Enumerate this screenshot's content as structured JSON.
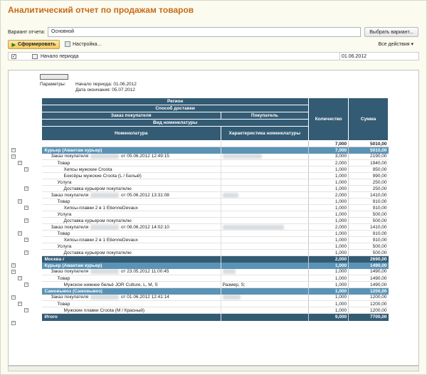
{
  "title": "Аналитический отчет по продажам товаров",
  "variant": {
    "label": "Вариант отчета:",
    "value": "Основной",
    "choose_button": "Выбрать вариант..."
  },
  "toolbar": {
    "form_button": "Сформировать",
    "settings": "Настройка...",
    "all_actions": "Все действия"
  },
  "period": {
    "label": "Начало периода",
    "value": "01.06.2012"
  },
  "params": {
    "label": "Параметры:",
    "start": "Начало периода: 01.06.2012",
    "end": "Дата окончания: 05.07.2012"
  },
  "headers": {
    "region": "Регион",
    "delivery": "Способ доставки",
    "order": "Заказ покупателя",
    "buyer": "Покупатель",
    "nomen_kind": "Вид номенклатуры",
    "nomen": "Номенклатура",
    "nomen_char": "Характеристика номенклатуры",
    "qty": "Количество",
    "sum": "Сумма"
  },
  "rows": [
    {
      "cls": "total",
      "indent": 0,
      "text": "",
      "char": "",
      "qty": "7,000",
      "sum": "5010,00"
    },
    {
      "cls": "g2",
      "indent": 0,
      "text": "Курьер (Авантаж курьер)",
      "char": "",
      "qty": "7,000",
      "sum": "5010,00"
    },
    {
      "cls": "r",
      "indent": 1,
      "text": "Заказ покупателя",
      "blur": "00000000000",
      "suffix": "от 05.06.2012 12:49:15",
      "buyer": "Фамилия Имя Отч",
      "qty": "3,000",
      "sum": "2190,00"
    },
    {
      "cls": "r",
      "indent": 2,
      "text": "Товар",
      "char": "",
      "qty": "2,000",
      "sum": "1940,00"
    },
    {
      "cls": "r",
      "indent": 3,
      "text": "Хипсы мужские Croota",
      "char": "",
      "qty": "1,000",
      "sum": "950,00"
    },
    {
      "cls": "r",
      "indent": 3,
      "text": "Боксёры мужские Croota (L / Белый)",
      "char": "",
      "qty": "1,000",
      "sum": "990,00"
    },
    {
      "cls": "r",
      "indent": 2,
      "text": "Услуга",
      "char": "",
      "qty": "1,000",
      "sum": "250,00"
    },
    {
      "cls": "r",
      "indent": 3,
      "text": "Доставка курьером покупателю",
      "char": "",
      "qty": "1,000",
      "sum": "250,00"
    },
    {
      "cls": "r",
      "indent": 1,
      "text": "Заказ покупателя",
      "blur": "00000000000",
      "suffix": "от 05.06.2012 13:31:08",
      "buyer": "Матвей",
      "qty": "2,000",
      "sum": "1410,00"
    },
    {
      "cls": "r",
      "indent": 2,
      "text": "Товар",
      "char": "",
      "qty": "1,000",
      "sum": "910,00"
    },
    {
      "cls": "r",
      "indent": 3,
      "text": "Хипсы-плавки 2 в 1 EtienneDevaux",
      "char": "",
      "qty": "1,000",
      "sum": "910,00"
    },
    {
      "cls": "r",
      "indent": 2,
      "text": "Услуга",
      "char": "",
      "qty": "1,000",
      "sum": "500,00"
    },
    {
      "cls": "r",
      "indent": 3,
      "text": "Доставка курьером покупателю",
      "char": "",
      "qty": "1,000",
      "sum": "500,00"
    },
    {
      "cls": "r",
      "indent": 1,
      "text": "Заказ покупателя",
      "blur": "00000000000",
      "suffix": "от 08.06.2012 14:02:10",
      "buyer": "Котов Дмитрий Анатольевич",
      "qty": "2,000",
      "sum": "1410,00"
    },
    {
      "cls": "r",
      "indent": 2,
      "text": "Товар",
      "char": "",
      "qty": "1,000",
      "sum": "910,00"
    },
    {
      "cls": "r",
      "indent": 3,
      "text": "Хипсы-плавки 2 в 1 EtienneDevaux",
      "char": "",
      "qty": "1,000",
      "sum": "910,00"
    },
    {
      "cls": "r",
      "indent": 2,
      "text": "Услуга",
      "char": "",
      "qty": "1,000",
      "sum": "500,00"
    },
    {
      "cls": "r",
      "indent": 3,
      "text": "Доставка курьером покупателю",
      "char": "",
      "qty": "1,000",
      "sum": "500,00"
    },
    {
      "cls": "g1",
      "indent": 0,
      "text": "Москва г",
      "char": "",
      "qty": "2,000",
      "sum": "2690,00"
    },
    {
      "cls": "g2",
      "indent": 0,
      "text": "Курьер (Авантаж курьер)",
      "char": "",
      "qty": "1,000",
      "sum": "1490,00"
    },
    {
      "cls": "r",
      "indent": 1,
      "text": "Заказ покупателя",
      "blur": "00000000000",
      "suffix": "от 23.05.2012 11:00:45",
      "buyer": "Алёна",
      "qty": "1,000",
      "sum": "1490,00"
    },
    {
      "cls": "r",
      "indent": 2,
      "text": "Товар",
      "char": "",
      "qty": "1,000",
      "sum": "1490,00"
    },
    {
      "cls": "r",
      "indent": 3,
      "text": "Мужское нижнее бельё JOR Culture, L, M, S",
      "char": "Размер, S;",
      "qty": "1,000",
      "sum": "1490,00"
    },
    {
      "cls": "g2",
      "indent": 0,
      "text": "Самовывоз (Самовывоз)",
      "char": "",
      "qty": "1,000",
      "sum": "1200,00"
    },
    {
      "cls": "r",
      "indent": 1,
      "text": "Заказ покупателя",
      "blur": "00000000000",
      "suffix": "от 01.06.2012 12:41:14",
      "buyer": "Алексей",
      "qty": "1,000",
      "sum": "1200,00"
    },
    {
      "cls": "r",
      "indent": 2,
      "text": "Товар",
      "char": "",
      "qty": "1,000",
      "sum": "1200,00"
    },
    {
      "cls": "r",
      "indent": 3,
      "text": "Мужские плавки Croota (M / Красный)",
      "char": "",
      "qty": "1,000",
      "sum": "1200,00"
    },
    {
      "cls": "grand",
      "indent": 0,
      "text": "Итого",
      "char": "",
      "qty": "9,000",
      "sum": "7700,00"
    }
  ]
}
